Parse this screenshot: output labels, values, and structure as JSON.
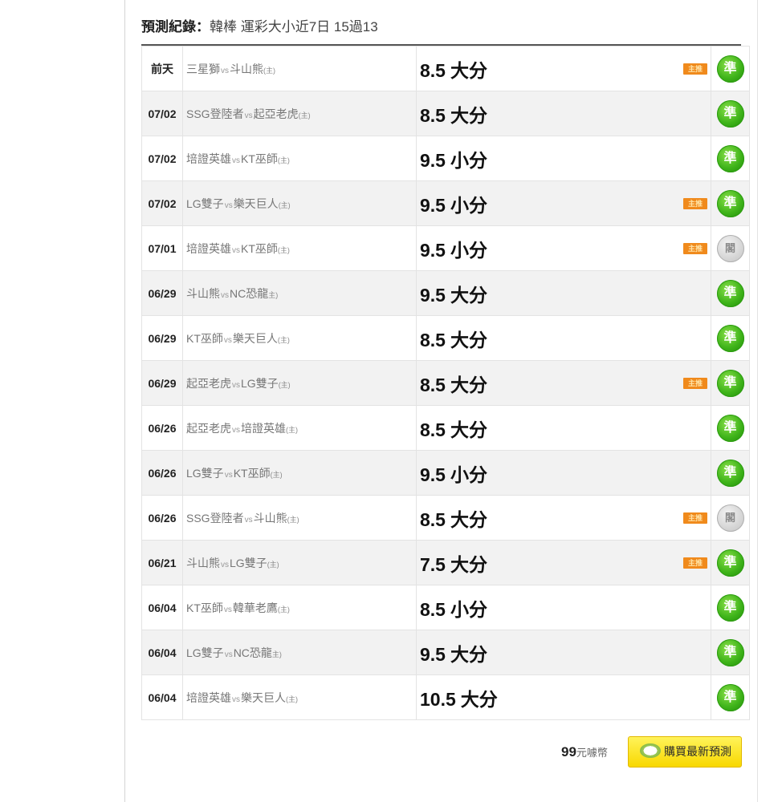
{
  "heading": {
    "label": "預測紀錄：",
    "text": "韓棒 運彩大小近7日 15過13"
  },
  "rows": [
    {
      "date": "前天",
      "away": "三星獅",
      "vs": "vs",
      "home": "斗山熊",
      "home_tag": "(主)",
      "pick_num": "8.5",
      "pick_dir": "大分",
      "main": true,
      "result": "準",
      "result_type": "hit"
    },
    {
      "date": "07/02",
      "away": "SSG登陸者",
      "vs": "vs",
      "home": "起亞老虎",
      "home_tag": "(主)",
      "pick_num": "8.5",
      "pick_dir": "大分",
      "main": false,
      "result": "準",
      "result_type": "hit"
    },
    {
      "date": "07/02",
      "away": "培證英雄",
      "vs": "vs",
      "home": "KT巫師",
      "home_tag": "(主)",
      "pick_num": "9.5",
      "pick_dir": "小分",
      "main": false,
      "result": "準",
      "result_type": "hit"
    },
    {
      "date": "07/02",
      "away": "LG雙子",
      "vs": "vs",
      "home": "樂天巨人",
      "home_tag": "(主)",
      "pick_num": "9.5",
      "pick_dir": "小分",
      "main": true,
      "result": "準",
      "result_type": "hit"
    },
    {
      "date": "07/01",
      "away": "培證英雄",
      "vs": "vs",
      "home": "KT巫師",
      "home_tag": "(主)",
      "pick_num": "9.5",
      "pick_dir": "小分",
      "main": true,
      "result": "閣",
      "result_type": "miss"
    },
    {
      "date": "06/29",
      "away": "斗山熊",
      "vs": "vs",
      "home": "NC恐龍",
      "home_tag": "主)",
      "pick_num": "9.5",
      "pick_dir": "大分",
      "main": false,
      "result": "準",
      "result_type": "hit"
    },
    {
      "date": "06/29",
      "away": "KT巫師",
      "vs": "vs",
      "home": "樂天巨人",
      "home_tag": "(主)",
      "pick_num": "8.5",
      "pick_dir": "大分",
      "main": false,
      "result": "準",
      "result_type": "hit"
    },
    {
      "date": "06/29",
      "away": "起亞老虎",
      "vs": "vs",
      "home": "LG雙子",
      "home_tag": "(主)",
      "pick_num": "8.5",
      "pick_dir": "大分",
      "main": true,
      "result": "準",
      "result_type": "hit"
    },
    {
      "date": "06/26",
      "away": "起亞老虎",
      "vs": "vs",
      "home": "培證英雄",
      "home_tag": "(主)",
      "pick_num": "8.5",
      "pick_dir": "大分",
      "main": false,
      "result": "準",
      "result_type": "hit"
    },
    {
      "date": "06/26",
      "away": "LG雙子",
      "vs": "vs",
      "home": "KT巫師",
      "home_tag": "(主)",
      "pick_num": "9.5",
      "pick_dir": "小分",
      "main": false,
      "result": "準",
      "result_type": "hit"
    },
    {
      "date": "06/26",
      "away": "SSG登陸者",
      "vs": "vs",
      "home": "斗山熊",
      "home_tag": "(主)",
      "pick_num": "8.5",
      "pick_dir": "大分",
      "main": true,
      "result": "閣",
      "result_type": "miss"
    },
    {
      "date": "06/21",
      "away": "斗山熊",
      "vs": "vs",
      "home": "LG雙子",
      "home_tag": "(主)",
      "pick_num": "7.5",
      "pick_dir": "大分",
      "main": true,
      "result": "準",
      "result_type": "hit"
    },
    {
      "date": "06/04",
      "away": "KT巫師",
      "vs": "vs",
      "home": "韓華老鷹",
      "home_tag": "(主)",
      "pick_num": "8.5",
      "pick_dir": "小分",
      "main": false,
      "result": "準",
      "result_type": "hit"
    },
    {
      "date": "06/04",
      "away": "LG雙子",
      "vs": "vs",
      "home": "NC恐龍",
      "home_tag": "主)",
      "pick_num": "9.5",
      "pick_dir": "大分",
      "main": false,
      "result": "準",
      "result_type": "hit"
    },
    {
      "date": "06/04",
      "away": "培證英雄",
      "vs": "vs",
      "home": "樂天巨人",
      "home_tag": "(主)",
      "pick_num": "10.5",
      "pick_dir": "大分",
      "main": false,
      "result": "準",
      "result_type": "hit"
    }
  ],
  "main_tag_label": "主推",
  "price": {
    "amount": "99",
    "unit": "元噱幣"
  },
  "buy_button": {
    "label": "購買最新預測",
    "icon": "coin-icon"
  },
  "colors": {
    "hit": "#3fb41a",
    "miss": "#c8c8c8",
    "main_tag": "#f08a1c",
    "buy_button": "#f8d800"
  }
}
